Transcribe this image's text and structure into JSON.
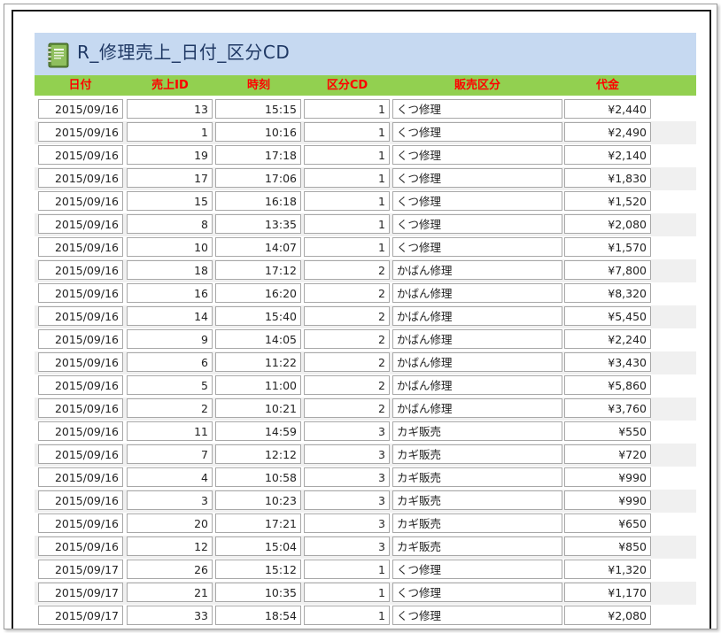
{
  "report": {
    "title": "R_修理売上_日付_区分CD",
    "columns": [
      "日付",
      "売上ID",
      "時刻",
      "区分CD",
      "販売区分",
      "代金"
    ]
  },
  "rows": [
    {
      "date": "2015/09/16",
      "id": "13",
      "time": "15:15",
      "cd": "1",
      "kubun": "くつ修理",
      "price": "¥2,440"
    },
    {
      "date": "2015/09/16",
      "id": "1",
      "time": "10:16",
      "cd": "1",
      "kubun": "くつ修理",
      "price": "¥2,490"
    },
    {
      "date": "2015/09/16",
      "id": "19",
      "time": "17:18",
      "cd": "1",
      "kubun": "くつ修理",
      "price": "¥2,140"
    },
    {
      "date": "2015/09/16",
      "id": "17",
      "time": "17:06",
      "cd": "1",
      "kubun": "くつ修理",
      "price": "¥1,830"
    },
    {
      "date": "2015/09/16",
      "id": "15",
      "time": "16:18",
      "cd": "1",
      "kubun": "くつ修理",
      "price": "¥1,520"
    },
    {
      "date": "2015/09/16",
      "id": "8",
      "time": "13:35",
      "cd": "1",
      "kubun": "くつ修理",
      "price": "¥2,080"
    },
    {
      "date": "2015/09/16",
      "id": "10",
      "time": "14:07",
      "cd": "1",
      "kubun": "くつ修理",
      "price": "¥1,570"
    },
    {
      "date": "2015/09/16",
      "id": "18",
      "time": "17:12",
      "cd": "2",
      "kubun": "かばん修理",
      "price": "¥7,800"
    },
    {
      "date": "2015/09/16",
      "id": "16",
      "time": "16:20",
      "cd": "2",
      "kubun": "かばん修理",
      "price": "¥8,320"
    },
    {
      "date": "2015/09/16",
      "id": "14",
      "time": "15:40",
      "cd": "2",
      "kubun": "かばん修理",
      "price": "¥5,450"
    },
    {
      "date": "2015/09/16",
      "id": "9",
      "time": "14:05",
      "cd": "2",
      "kubun": "かばん修理",
      "price": "¥2,240"
    },
    {
      "date": "2015/09/16",
      "id": "6",
      "time": "11:22",
      "cd": "2",
      "kubun": "かばん修理",
      "price": "¥3,430"
    },
    {
      "date": "2015/09/16",
      "id": "5",
      "time": "11:00",
      "cd": "2",
      "kubun": "かばん修理",
      "price": "¥5,860"
    },
    {
      "date": "2015/09/16",
      "id": "2",
      "time": "10:21",
      "cd": "2",
      "kubun": "かばん修理",
      "price": "¥3,760"
    },
    {
      "date": "2015/09/16",
      "id": "11",
      "time": "14:59",
      "cd": "3",
      "kubun": "カギ販売",
      "price": "¥550"
    },
    {
      "date": "2015/09/16",
      "id": "7",
      "time": "12:12",
      "cd": "3",
      "kubun": "カギ販売",
      "price": "¥720"
    },
    {
      "date": "2015/09/16",
      "id": "4",
      "time": "10:58",
      "cd": "3",
      "kubun": "カギ販売",
      "price": "¥990"
    },
    {
      "date": "2015/09/16",
      "id": "3",
      "time": "10:23",
      "cd": "3",
      "kubun": "カギ販売",
      "price": "¥990"
    },
    {
      "date": "2015/09/16",
      "id": "20",
      "time": "17:21",
      "cd": "3",
      "kubun": "カギ販売",
      "price": "¥650"
    },
    {
      "date": "2015/09/16",
      "id": "12",
      "time": "15:04",
      "cd": "3",
      "kubun": "カギ販売",
      "price": "¥850"
    },
    {
      "date": "2015/09/17",
      "id": "26",
      "time": "15:12",
      "cd": "1",
      "kubun": "くつ修理",
      "price": "¥1,320"
    },
    {
      "date": "2015/09/17",
      "id": "21",
      "time": "10:35",
      "cd": "1",
      "kubun": "くつ修理",
      "price": "¥1,170"
    },
    {
      "date": "2015/09/17",
      "id": "33",
      "time": "18:54",
      "cd": "1",
      "kubun": "くつ修理",
      "price": "¥2,080"
    }
  ],
  "colors": {
    "title_band": "#c6d9f1",
    "header_band": "#92d050",
    "header_text": "#ff0000",
    "title_text": "#1f3864"
  },
  "icons": {
    "title": "notebook-icon"
  }
}
